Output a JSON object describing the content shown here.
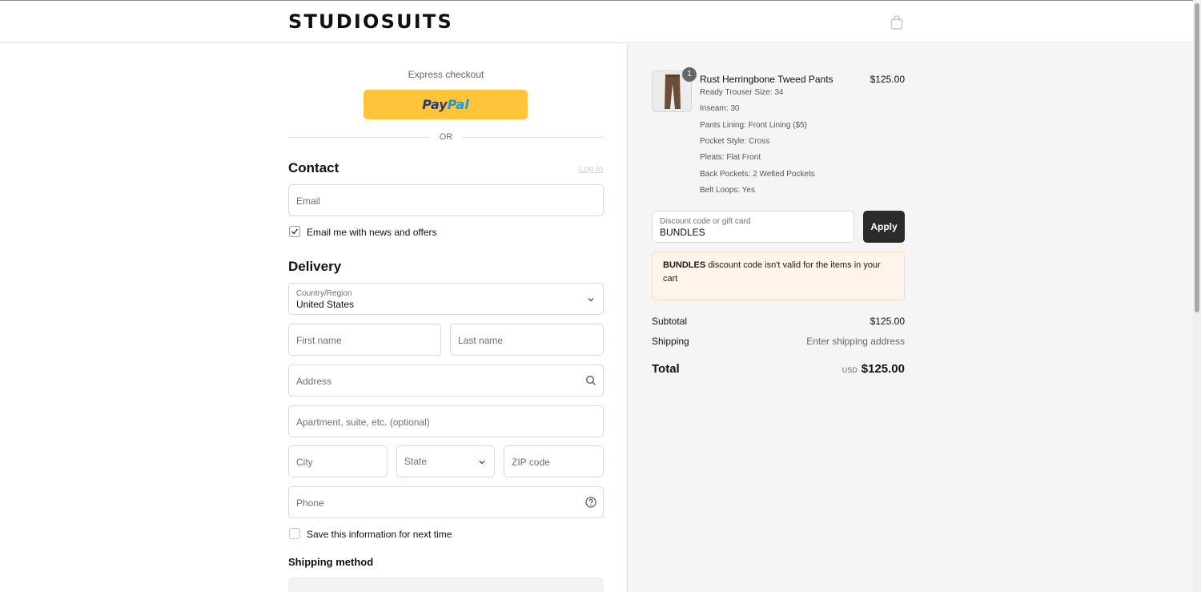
{
  "header": {
    "logo": "STUDIOSUITS"
  },
  "express": {
    "label": "Express checkout",
    "paypal_pay": "Pay",
    "paypal_pal": "Pal",
    "or": "OR"
  },
  "contact": {
    "title": "Contact",
    "login": "Log in",
    "email_placeholder": "Email",
    "news_label": "Email me with news and offers",
    "news_checked": true
  },
  "delivery": {
    "title": "Delivery",
    "country_label": "Country/Region",
    "country_value": "United States",
    "first_name": "First name",
    "last_name": "Last name",
    "address": "Address",
    "apartment": "Apartment, suite, etc. (optional)",
    "city": "City",
    "state": "State",
    "zip": "ZIP code",
    "phone": "Phone",
    "save_label": "Save this information for next time",
    "save_checked": false
  },
  "shipping_method": {
    "title": "Shipping method"
  },
  "cart": {
    "quantity": "1",
    "product_name": "Rust Herringbone Tweed Pants",
    "price": "$125.00",
    "options": [
      "Ready Trouser Size: 34",
      "Inseam: 30",
      "Pants Lining: Front Lining ($5)",
      "Pocket Style: Cross",
      "Pleats: Flat Front",
      "Back Pockets: 2 Welted Pockets",
      "Belt Loops: Yes"
    ]
  },
  "discount": {
    "label": "Discount code or gift card",
    "value": "BUNDLES",
    "apply": "Apply",
    "error_code": "BUNDLES",
    "error_text": " discount code isn't valid for the items in your cart"
  },
  "summary": {
    "subtotal_label": "Subtotal",
    "subtotal_value": "$125.00",
    "shipping_label": "Shipping",
    "shipping_value": "Enter shipping address",
    "total_label": "Total",
    "currency": "USD",
    "total_value": "$125.00"
  },
  "colors": {
    "paypal_yellow": "#ffc43a",
    "apply_button": "#2b2b2b",
    "error_background": "#fff4ea"
  }
}
